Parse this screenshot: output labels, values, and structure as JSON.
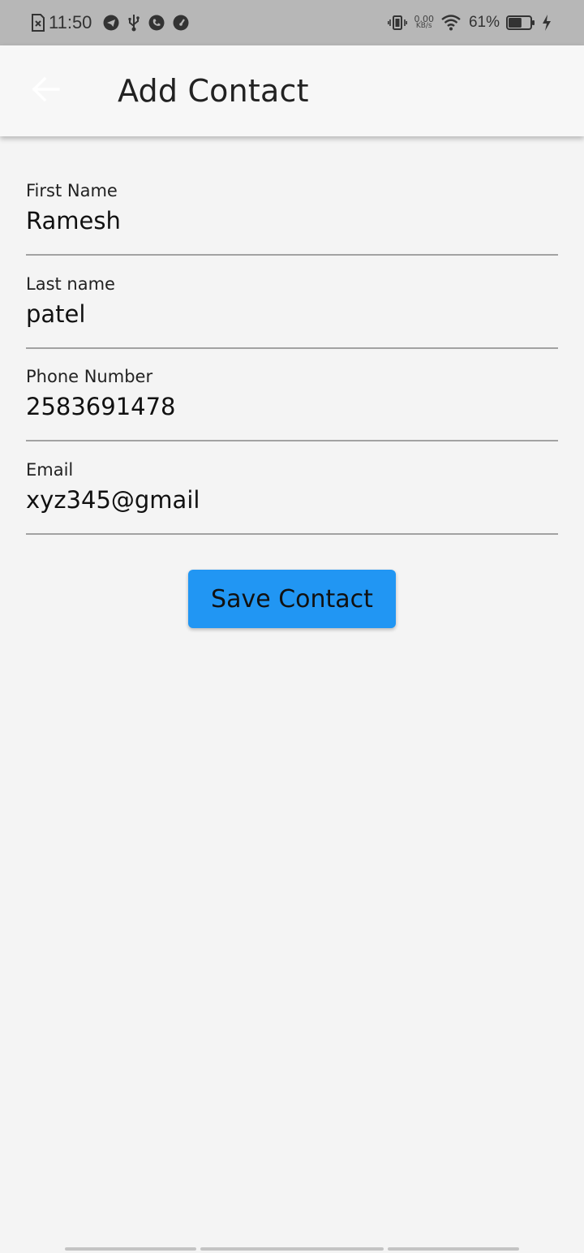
{
  "status_bar": {
    "time": "11:50",
    "left_icons": [
      "sim-error-icon",
      "telegram-icon",
      "usb-icon",
      "phone-icon",
      "speedometer-icon"
    ],
    "right_icons": [
      "vibrate-icon",
      "wifi-icon",
      "battery-icon",
      "charging-icon"
    ],
    "network_speed_value": "0.00",
    "network_speed_unit": "KB/s",
    "battery_percent": "61%",
    "battery_level": 0.61
  },
  "app_bar": {
    "back_icon": "arrow-back-icon",
    "title": "Add Contact"
  },
  "form": {
    "fields": [
      {
        "label": "First Name",
        "value": "Ramesh"
      },
      {
        "label": "Last name",
        "value": "patel"
      },
      {
        "label": "Phone Number",
        "value": "2583691478"
      },
      {
        "label": "Email",
        "value": "xyz345@gmail"
      }
    ],
    "save_label": "Save Contact"
  },
  "colors": {
    "status_bar": "#b7b7b7",
    "app_bar": "#f7f7f7",
    "background": "#f4f4f4",
    "accent_button": "#2196f3",
    "underline": "#a2a2a2"
  }
}
